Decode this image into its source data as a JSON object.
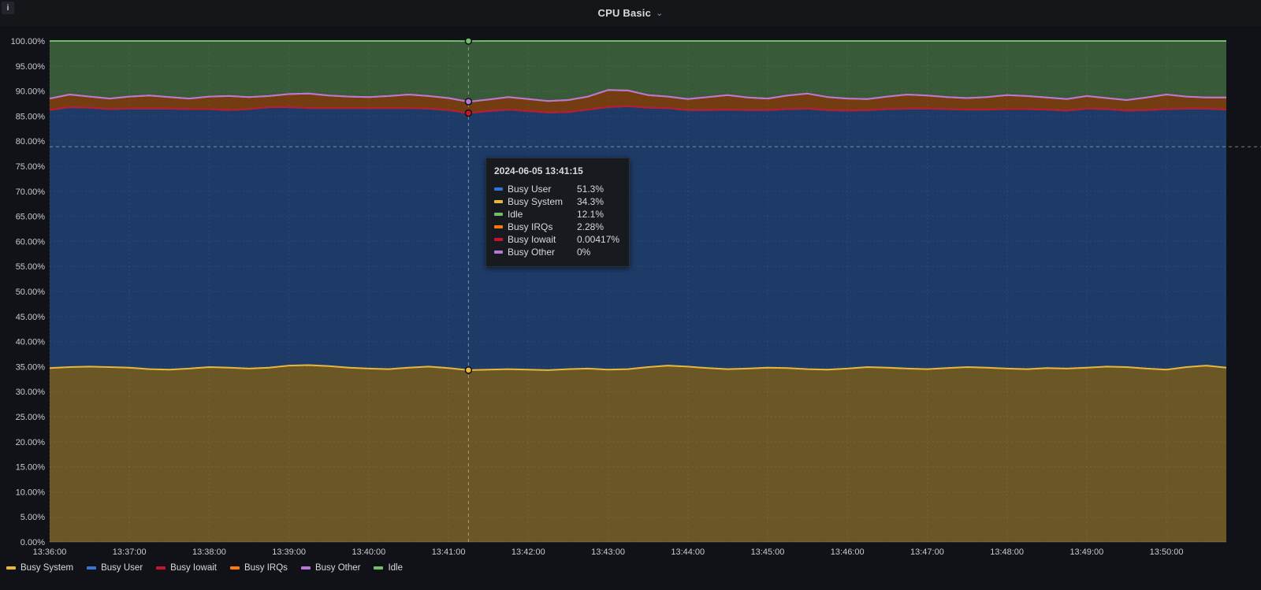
{
  "panel": {
    "title": "CPU Basic",
    "chevron_icon": "⌄",
    "info_icon": "i"
  },
  "colors": {
    "background": "#111217",
    "header_background": "#141619",
    "axis_text": "#c7cbd1",
    "grid": "#ffffff",
    "crosshair": "#d0d4d9",
    "tooltip_background": "#17191d",
    "fill_opacity": 0.42
  },
  "chart_data": {
    "type": "area",
    "stacked": true,
    "title": "CPU Basic",
    "x_start_seconds": 0,
    "x_step_seconds": 15,
    "x_end_seconds": 885,
    "x_tick_seconds": [
      0,
      60,
      120,
      180,
      240,
      300,
      360,
      420,
      480,
      540,
      600,
      660,
      720,
      780,
      840
    ],
    "x_tick_labels": [
      "13:36:00",
      "13:37:00",
      "13:38:00",
      "13:39:00",
      "13:40:00",
      "13:41:00",
      "13:42:00",
      "13:43:00",
      "13:44:00",
      "13:45:00",
      "13:46:00",
      "13:47:00",
      "13:48:00",
      "13:49:00",
      "13:50:00"
    ],
    "ylim": [
      0,
      100
    ],
    "y_tick_step": 5,
    "y_tick_labels": [
      "0.00%",
      "5.00%",
      "10.00%",
      "15.00%",
      "20.00%",
      "25.00%",
      "30.00%",
      "35.00%",
      "40.00%",
      "45.00%",
      "50.00%",
      "55.00%",
      "60.00%",
      "65.00%",
      "70.00%",
      "75.00%",
      "80.00%",
      "85.00%",
      "90.00%",
      "95.00%",
      "100.00%"
    ],
    "legend_position": "bottom",
    "legend": [
      "Busy System",
      "Busy User",
      "Busy Iowait",
      "Busy IRQs",
      "Busy Other",
      "Idle"
    ],
    "series": [
      {
        "name": "Busy System",
        "color": "#EAB839",
        "values": [
          34.7,
          34.9,
          35.0,
          34.9,
          34.8,
          34.5,
          34.4,
          34.6,
          34.9,
          34.8,
          34.6,
          34.8,
          35.2,
          35.3,
          35.1,
          34.8,
          34.6,
          34.5,
          34.8,
          35.0,
          34.7,
          34.3,
          34.4,
          34.5,
          34.4,
          34.3,
          34.5,
          34.6,
          34.4,
          34.5,
          34.9,
          35.2,
          35.0,
          34.7,
          34.5,
          34.6,
          34.8,
          34.7,
          34.5,
          34.4,
          34.6,
          34.9,
          34.8,
          34.6,
          34.5,
          34.7,
          34.9,
          34.8,
          34.6,
          34.5,
          34.7,
          34.6,
          34.8,
          35.0,
          34.9,
          34.6,
          34.4,
          34.9,
          35.2,
          34.8
        ]
      },
      {
        "name": "Busy User",
        "color": "#3274D9",
        "values": [
          51.5,
          51.9,
          51.7,
          51.5,
          51.7,
          52.0,
          52.1,
          51.8,
          51.5,
          51.4,
          51.8,
          52.0,
          51.6,
          51.3,
          51.5,
          51.8,
          52.0,
          52.1,
          51.8,
          51.5,
          51.5,
          51.3,
          51.6,
          51.8,
          51.6,
          51.4,
          51.3,
          51.7,
          52.4,
          52.5,
          51.8,
          51.4,
          51.2,
          51.5,
          51.8,
          51.6,
          51.4,
          51.7,
          52.0,
          51.8,
          51.5,
          51.3,
          51.6,
          51.9,
          52.0,
          51.7,
          51.4,
          51.5,
          51.8,
          51.9,
          51.6,
          51.5,
          51.7,
          51.4,
          51.2,
          51.6,
          52.0,
          51.6,
          51.3,
          51.5
        ]
      },
      {
        "name": "Busy Iowait",
        "color": "#C4162A",
        "values_all": 0.00417
      },
      {
        "name": "Busy IRQs",
        "color": "#FF780A",
        "values": [
          2.3,
          2.5,
          2.2,
          2.1,
          2.4,
          2.6,
          2.3,
          2.1,
          2.5,
          2.8,
          2.4,
          2.2,
          2.6,
          2.9,
          2.5,
          2.3,
          2.2,
          2.4,
          2.7,
          2.5,
          2.4,
          2.28,
          2.3,
          2.5,
          2.4,
          2.3,
          2.4,
          2.6,
          3.4,
          3.1,
          2.5,
          2.3,
          2.2,
          2.6,
          2.9,
          2.5,
          2.3,
          2.7,
          3.0,
          2.6,
          2.4,
          2.2,
          2.5,
          2.8,
          2.6,
          2.4,
          2.3,
          2.5,
          2.8,
          2.6,
          2.4,
          2.3,
          2.5,
          2.2,
          2.1,
          2.5,
          2.9,
          2.4,
          2.2,
          2.4
        ]
      },
      {
        "name": "Busy Other",
        "color": "#B877D9",
        "values_all": 0
      },
      {
        "name": "Idle",
        "color": "#73BF69",
        "values": [
          11.5,
          10.7,
          11.1,
          11.5,
          11.1,
          10.9,
          11.2,
          11.5,
          11.1,
          11.0,
          11.2,
          11.0,
          10.6,
          10.5,
          10.9,
          11.1,
          11.2,
          11.0,
          10.7,
          11.0,
          11.4,
          12.1,
          11.7,
          11.2,
          11.6,
          12.0,
          11.8,
          11.1,
          9.8,
          9.9,
          10.8,
          11.1,
          11.6,
          11.2,
          10.8,
          11.3,
          11.5,
          10.9,
          10.5,
          11.2,
          11.5,
          11.6,
          11.1,
          10.7,
          10.9,
          11.2,
          11.4,
          11.2,
          10.8,
          11.0,
          11.3,
          11.6,
          11.0,
          11.4,
          11.8,
          11.3,
          10.7,
          11.1,
          11.3,
          11.3
        ]
      }
    ]
  },
  "crosshair": {
    "x_seconds": 315,
    "y_percent": 78.9
  },
  "hover_points": [
    {
      "series": "Busy System",
      "color": "#EAB839",
      "y_percent": 34.3
    },
    {
      "series": "Busy Iowait",
      "color": "#C4162A",
      "y_percent": 85.6
    },
    {
      "series": "Busy Other",
      "color": "#B877D9",
      "y_percent": 87.9
    },
    {
      "series": "Idle",
      "color": "#73BF69",
      "y_percent": 100
    }
  ],
  "tooltip": {
    "timestamp": "2024-06-05 13:41:15",
    "rows": [
      {
        "name": "Busy User",
        "value": "51.3%",
        "color": "#3274D9"
      },
      {
        "name": "Busy System",
        "value": "34.3%",
        "color": "#EAB839"
      },
      {
        "name": "Idle",
        "value": "12.1%",
        "color": "#73BF69"
      },
      {
        "name": "Busy IRQs",
        "value": "2.28%",
        "color": "#FF780A"
      },
      {
        "name": "Busy Iowait",
        "value": "0.00417%",
        "color": "#C4162A"
      },
      {
        "name": "Busy Other",
        "value": "0%",
        "color": "#B877D9"
      }
    ]
  }
}
